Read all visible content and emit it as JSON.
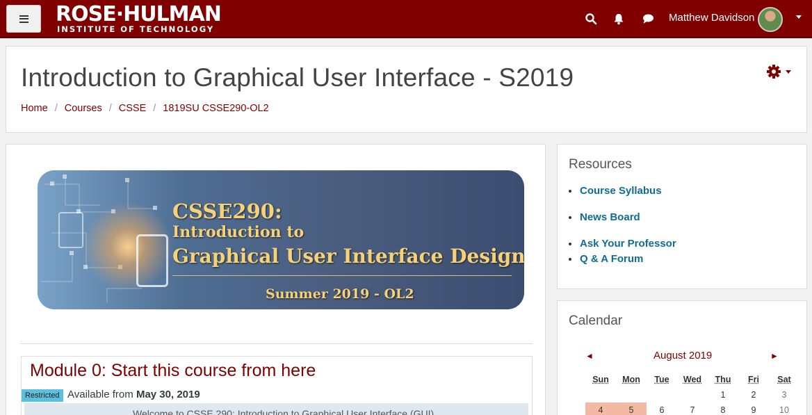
{
  "navbar": {
    "logo_line1": "ROSE·HULMAN",
    "logo_line2": "INSTITUTE OF TECHNOLOGY",
    "user_name": "Matthew Davidson",
    "icons": [
      "menu-icon",
      "search-icon",
      "bell-icon",
      "chat-icon",
      "caret-down-icon"
    ],
    "color": "#800000"
  },
  "header": {
    "title": "Introduction to Graphical User Interface - S2019",
    "breadcrumb": [
      "Home",
      "Courses",
      "CSSE",
      "1819SU CSSE290-OL2"
    ],
    "separator": "/"
  },
  "banner": {
    "line1": "CSSE290:",
    "line2": "Introduction to",
    "line3": "Graphical User Interface Design",
    "line4": "Summer 2019 - OL2"
  },
  "module": {
    "title": "Module 0: Start this course from here",
    "badge": "Restricted",
    "available_prefix": "Available from",
    "available_date": "May 30, 2019",
    "welcome": "Welcome to CSSE 290: Introduction to Graphical User Interface (GUI)"
  },
  "resources": {
    "title": "Resources",
    "items": [
      "Course Syllabus",
      "News Board",
      "Ask Your Professor",
      "Q & A Forum"
    ]
  },
  "calendar": {
    "title": "Calendar",
    "month": "August 2019",
    "prev": "◄",
    "next": "►",
    "days": [
      "Sun",
      "Mon",
      "Tue",
      "Wed",
      "Thu",
      "Fri",
      "Sat"
    ],
    "week1": [
      "",
      "",
      "",
      "",
      "1",
      "2",
      "3"
    ],
    "week2": [
      "4",
      "5",
      "6",
      "7",
      "8",
      "9",
      "10"
    ]
  }
}
